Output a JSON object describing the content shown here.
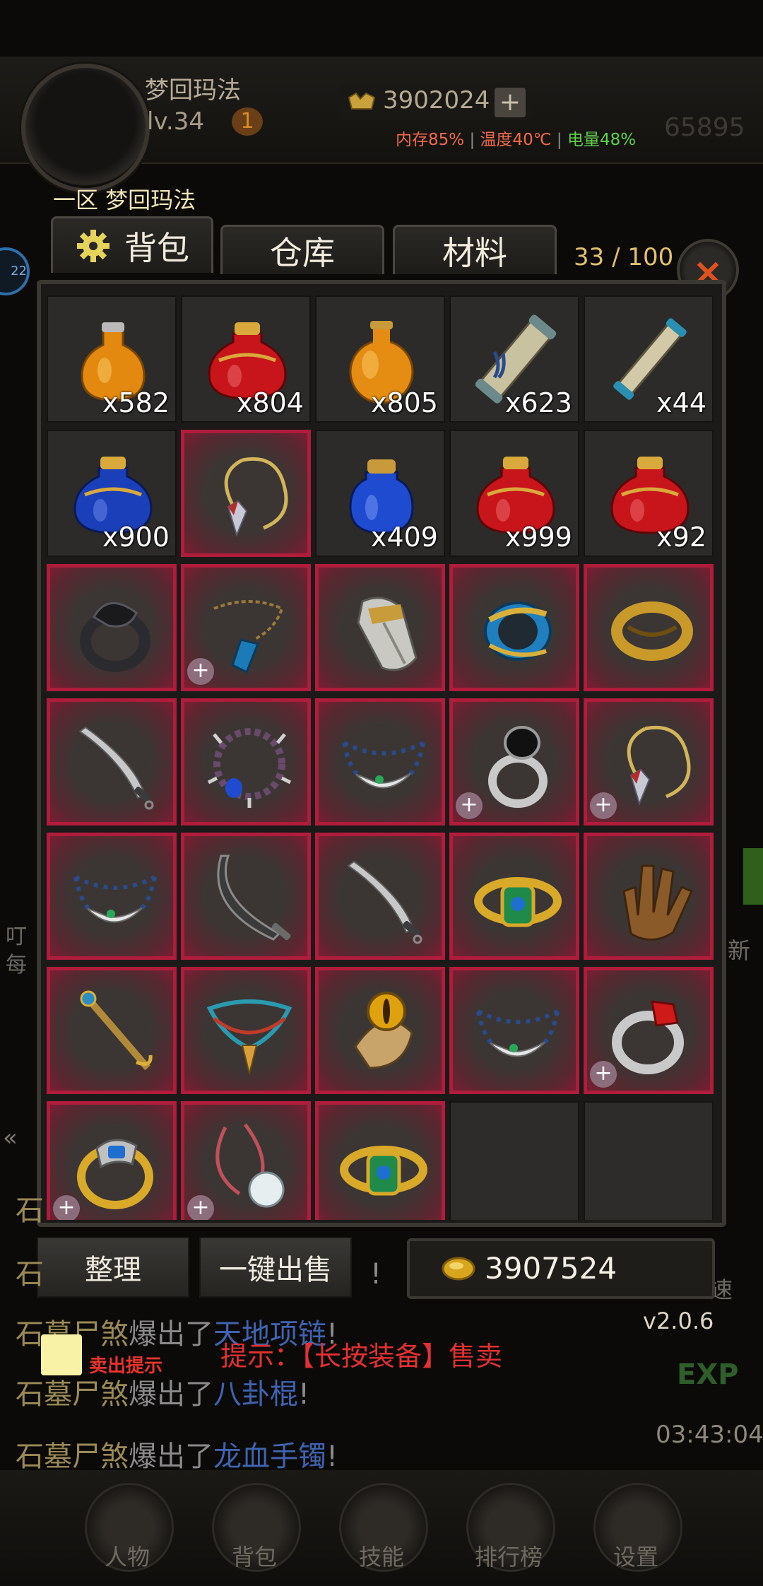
{
  "header": {
    "player_name": "梦回玛法",
    "level": "lv.34",
    "vip": "1",
    "gold": "3902024",
    "gold_plus": "+",
    "status": {
      "memory": "内存85%",
      "temperature": "温度40℃",
      "battery": "电量48%"
    },
    "bg_number": "65895",
    "server_line": "一区  梦回玛法"
  },
  "tabs": {
    "bag": "背包",
    "storage": "仓库",
    "materials": "材料"
  },
  "capacity": "33 / 100",
  "close": "×",
  "side": {
    "left_orb": "22",
    "left_text1": "叮",
    "left_text2": "每",
    "left_arrow": "«",
    "right_text1": "新",
    "right_text2": "速"
  },
  "items": [
    {
      "icon": "orange-potion-icon",
      "count": "x582",
      "equip": false
    },
    {
      "icon": "red-potion-icon",
      "count": "x804",
      "equip": false
    },
    {
      "icon": "orange-round-potion-icon",
      "count": "x805",
      "equip": false
    },
    {
      "icon": "scroll-icon",
      "count": "x623",
      "equip": false
    },
    {
      "icon": "scroll-small-icon",
      "count": "x44",
      "equip": false
    },
    {
      "icon": "blue-potion-icon",
      "count": "x900",
      "equip": false
    },
    {
      "icon": "pendant-necklace-icon",
      "count": "",
      "equip": true
    },
    {
      "icon": "blue-small-potion-icon",
      "count": "x409",
      "equip": false
    },
    {
      "icon": "red-potion-icon",
      "count": "x999",
      "equip": false
    },
    {
      "icon": "red-potion-icon",
      "count": "x92",
      "equip": false
    },
    {
      "icon": "dark-ring-icon",
      "count": "",
      "equip": true
    },
    {
      "icon": "chain-necklace-icon",
      "count": "",
      "equip": true,
      "plus": true
    },
    {
      "icon": "silver-bracer-icon",
      "count": "",
      "equip": true
    },
    {
      "icon": "blue-bracelet-icon",
      "count": "",
      "equip": true
    },
    {
      "icon": "gold-ring-icon",
      "count": "",
      "equip": true
    },
    {
      "icon": "saber-icon",
      "count": "",
      "equip": true
    },
    {
      "icon": "spiked-bead-necklace-icon",
      "count": "",
      "equip": true
    },
    {
      "icon": "bead-necklace-icon",
      "count": "",
      "equip": true
    },
    {
      "icon": "black-gem-ring-icon",
      "count": "",
      "equip": true,
      "plus": true
    },
    {
      "icon": "pendant-necklace-icon",
      "count": "",
      "equip": true,
      "plus": true
    },
    {
      "icon": "bead-necklace-icon",
      "count": "",
      "equip": true
    },
    {
      "icon": "curved-blade-icon",
      "count": "",
      "equip": true
    },
    {
      "icon": "saber-icon",
      "count": "",
      "equip": true
    },
    {
      "icon": "jade-bracelet-icon",
      "count": "",
      "equip": true
    },
    {
      "icon": "gauntlet-icon",
      "count": "",
      "equip": true
    },
    {
      "icon": "staff-icon",
      "count": "",
      "equip": true
    },
    {
      "icon": "colorful-necklace-icon",
      "count": "",
      "equip": true
    },
    {
      "icon": "amber-ring-icon",
      "count": "",
      "equip": true
    },
    {
      "icon": "bead-necklace-icon",
      "count": "",
      "equip": true
    },
    {
      "icon": "red-gem-ring-icon",
      "count": "",
      "equip": true,
      "plus": true
    },
    {
      "icon": "blue-gem-ring-icon",
      "count": "",
      "equip": true,
      "plus": true
    },
    {
      "icon": "pearl-necklace-icon",
      "count": "",
      "equip": true,
      "plus": true
    },
    {
      "icon": "jade-bracelet-icon",
      "count": "",
      "equip": true
    },
    {
      "icon": "empty",
      "count": "",
      "equip": false,
      "empty": true
    },
    {
      "icon": "empty",
      "count": "",
      "equip": false,
      "empty": true
    }
  ],
  "buttons": {
    "sort": "整理",
    "sell_all": "一键出售"
  },
  "coins": "3907524",
  "log": [
    {
      "mob": "石",
      "text": "",
      "item": "",
      "end": ""
    },
    {
      "mob": "石",
      "text": "",
      "item": "",
      "end": "!"
    },
    {
      "mob": "石墓尸煞",
      "text": "爆出了",
      "item": "天地项链",
      "end": "!"
    },
    {
      "mob": "石墓尸煞",
      "text": "爆出了",
      "item": "八卦棍",
      "end": "!"
    },
    {
      "mob": "石墓尸煞",
      "text": "爆出了",
      "item": "龙血手镯",
      "end": "!"
    }
  ],
  "version": "v2.0.6",
  "sell_hint_label": "卖出提示",
  "hint": "提示：【长按装备】售卖",
  "exp": "EXP",
  "clock": "03:43:04",
  "nav": [
    "人物",
    "背包",
    "技能",
    "排行榜",
    "设置"
  ],
  "colors": {
    "equip_border": "#b01c3c",
    "accent_gold": "#e2c06c",
    "close_x": "#e0521c",
    "hint_red": "#e23131"
  }
}
